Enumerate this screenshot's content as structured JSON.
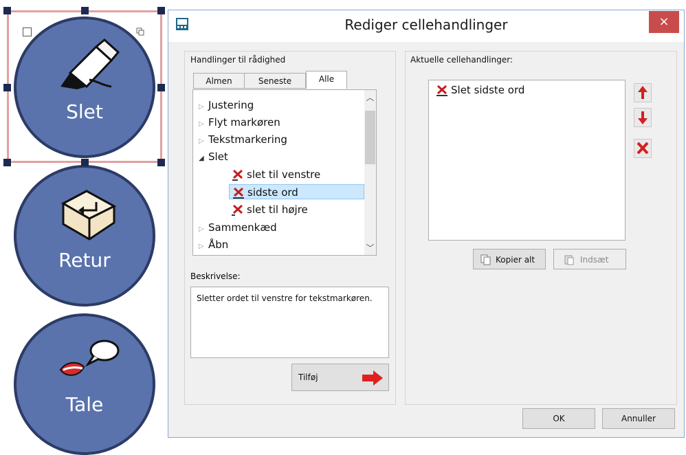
{
  "cells": [
    {
      "label": "Slet",
      "icon": "eraser-icon"
    },
    {
      "label": "Retur",
      "icon": "enter-key-icon"
    },
    {
      "label": "Tale",
      "icon": "speech-mouth-icon"
    }
  ],
  "dialog": {
    "title": "Rediger cellehandlinger",
    "close_label": "×",
    "available_group_title": "Handlinger til rådighed",
    "tabs": [
      {
        "label": "Almen",
        "active": false
      },
      {
        "label": "Seneste",
        "active": false
      },
      {
        "label": "Alle",
        "active": true
      }
    ],
    "tree": [
      {
        "label": "Justering",
        "level": 0,
        "expanded": false
      },
      {
        "label": "Flyt markøren",
        "level": 0,
        "expanded": false
      },
      {
        "label": "Tekstmarkering",
        "level": 0,
        "expanded": false
      },
      {
        "label": "Slet",
        "level": 0,
        "expanded": true
      },
      {
        "label": "slet til venstre",
        "level": 1,
        "icon": "delete-left-icon"
      },
      {
        "label": "sidste ord",
        "level": 1,
        "icon": "delete-word-icon",
        "selected": true
      },
      {
        "label": "slet til højre",
        "level": 1,
        "icon": "delete-right-icon"
      },
      {
        "label": "Sammenkæd",
        "level": 0,
        "expanded": false
      },
      {
        "label": "Åbn",
        "level": 0,
        "expanded": false
      }
    ],
    "description_label": "Beskrivelse:",
    "description_text": "Sletter ordet til venstre for tekstmarkøren.",
    "add_button_label": "Tilføj",
    "current_group_title": "Aktuelle cellehandlinger:",
    "current_actions": [
      {
        "label": "Slet sidste ord",
        "icon": "delete-word-icon"
      }
    ],
    "copy_all_label": "Kopier alt",
    "paste_label": "Indsæt",
    "ok_label": "OK",
    "cancel_label": "Annuller"
  },
  "colors": {
    "cell_fill": "#5a73ac",
    "cell_border": "#2c3b66",
    "selection_border": "#e3a0a0",
    "accent_red": "#d32020",
    "close_red": "#c94c4c"
  }
}
